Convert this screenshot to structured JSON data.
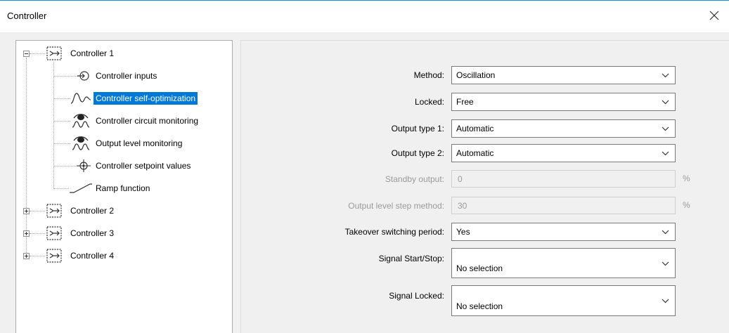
{
  "window": {
    "title": "Controller"
  },
  "tree": {
    "items": [
      {
        "label": "Controller 1",
        "icon": "controller-block-icon",
        "expanded": true
      },
      {
        "label": "Controller inputs",
        "icon": "input-arrow-icon"
      },
      {
        "label": "Controller self-optimization",
        "icon": "oscillation-wave-icon",
        "selected": true
      },
      {
        "label": "Controller circuit monitoring",
        "icon": "eye-wave-icon"
      },
      {
        "label": "Output level monitoring",
        "icon": "eye-wave-icon"
      },
      {
        "label": "Controller setpoint values",
        "icon": "setpoint-crosshair-icon"
      },
      {
        "label": "Ramp function",
        "icon": "ramp-icon"
      },
      {
        "label": "Controller 2",
        "icon": "controller-block-icon",
        "expanded": false
      },
      {
        "label": "Controller 3",
        "icon": "controller-block-icon",
        "expanded": false
      },
      {
        "label": "Controller 4",
        "icon": "controller-block-icon",
        "expanded": false
      }
    ]
  },
  "form": {
    "method": {
      "label": "Method:",
      "value": "Oscillation"
    },
    "locked": {
      "label": "Locked:",
      "value": "Free"
    },
    "output_type_1": {
      "label": "Output type 1:",
      "value": "Automatic"
    },
    "output_type_2": {
      "label": "Output type 2:",
      "value": "Automatic"
    },
    "standby_output": {
      "label": "Standby output:",
      "value": "0",
      "unit": "%"
    },
    "output_level_step": {
      "label": "Output level step method:",
      "value": "30",
      "unit": "%"
    },
    "takeover": {
      "label": "Takeover switching period:",
      "value": "Yes"
    },
    "signal_start_stop": {
      "label": "Signal Start/Stop:",
      "value": "No selection"
    },
    "signal_locked": {
      "label": "Signal Locked:",
      "value": "No selection"
    }
  },
  "colors": {
    "selection": "#0078d7",
    "accent_line": "#1e88e5",
    "disabled_text": "#9a9a9a"
  }
}
